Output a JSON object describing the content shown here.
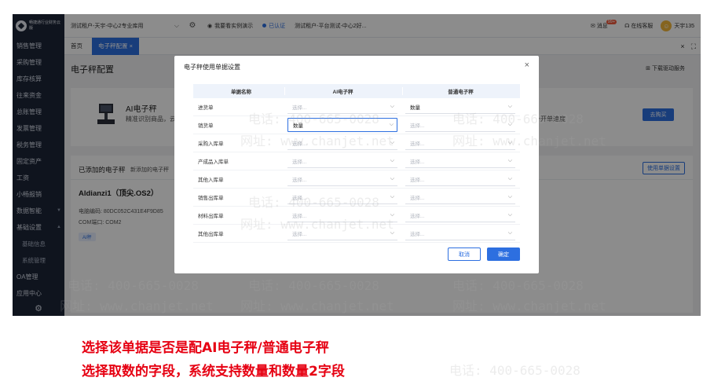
{
  "app": {
    "logo_text": "畅捷通行业财务云版",
    "tenant": "测试租户-天宇-中心2专业库用",
    "top_links": {
      "demo": "我要看实例演示",
      "certified": "已认证",
      "org": "测试租户-平台测试-中心2好..."
    },
    "top_right": {
      "message": "消息",
      "message_badge": "99+",
      "service": "在线客服",
      "user": "天宇135"
    }
  },
  "sidebar": {
    "items": [
      {
        "label": "销售管理"
      },
      {
        "label": "采购管理"
      },
      {
        "label": "库存核算"
      },
      {
        "label": "往来资金"
      },
      {
        "label": "总账管理"
      },
      {
        "label": "发票管理"
      },
      {
        "label": "税务管理"
      },
      {
        "label": "固定资产"
      },
      {
        "label": "工资"
      },
      {
        "label": "小畅报销"
      },
      {
        "label": "数据智能"
      },
      {
        "label": "基础设置"
      },
      {
        "label": "基础信息"
      },
      {
        "label": "系统管理"
      },
      {
        "label": "OA管理"
      },
      {
        "label": "应用中心"
      }
    ]
  },
  "tabs": {
    "home": "首页",
    "active": "电子秤配置"
  },
  "page": {
    "title": "电子秤配置",
    "download": "下载驱动服务",
    "ai_card": {
      "title": "AI电子秤",
      "desc": "精准识别商品，云",
      "desc_right": "升开单速度",
      "buy": "去购买"
    },
    "added": {
      "title": "已添加的电子秤",
      "subtitle": "新添加的电子秤",
      "doc_setting": "使用单据设置",
      "device": {
        "name": "Aldianzi1（顶尖.OS2）",
        "code": "电脑编码: 80DC052C431E4F9D85",
        "port": "COM端口: COM2",
        "tag": "AI秤"
      }
    }
  },
  "modal": {
    "title": "电子秤使用单据设置",
    "headers": {
      "name": "单据名称",
      "ai": "AI电子秤",
      "normal": "普通电子秤"
    },
    "placeholder": "选择...",
    "rows": [
      {
        "name": "进货单",
        "ai": "",
        "normal": "数量"
      },
      {
        "name": "销货单",
        "ai": "数量",
        "normal": ""
      },
      {
        "name": "采购入库单",
        "ai": "",
        "normal": ""
      },
      {
        "name": "产成品入库单",
        "ai": "",
        "normal": ""
      },
      {
        "name": "其他入库单",
        "ai": "",
        "normal": ""
      },
      {
        "name": "销售出库单",
        "ai": "",
        "normal": ""
      },
      {
        "name": "材料出库单",
        "ai": "",
        "normal": ""
      },
      {
        "name": "其他出库单",
        "ai": "",
        "normal": ""
      }
    ],
    "cancel": "取消",
    "ok": "确定"
  },
  "watermark": {
    "phone": "电话: 400-665-0028",
    "site": "网址: www.chanjet.net"
  },
  "notes": [
    "选择该单据是否是配AI电子秤/普通电子秤",
    "选择取数的字段，系统支持数量和数量2字段"
  ],
  "colors": {
    "accent": "#2d6fe0",
    "sidebar": "#1d2638",
    "note": "#e60012"
  }
}
